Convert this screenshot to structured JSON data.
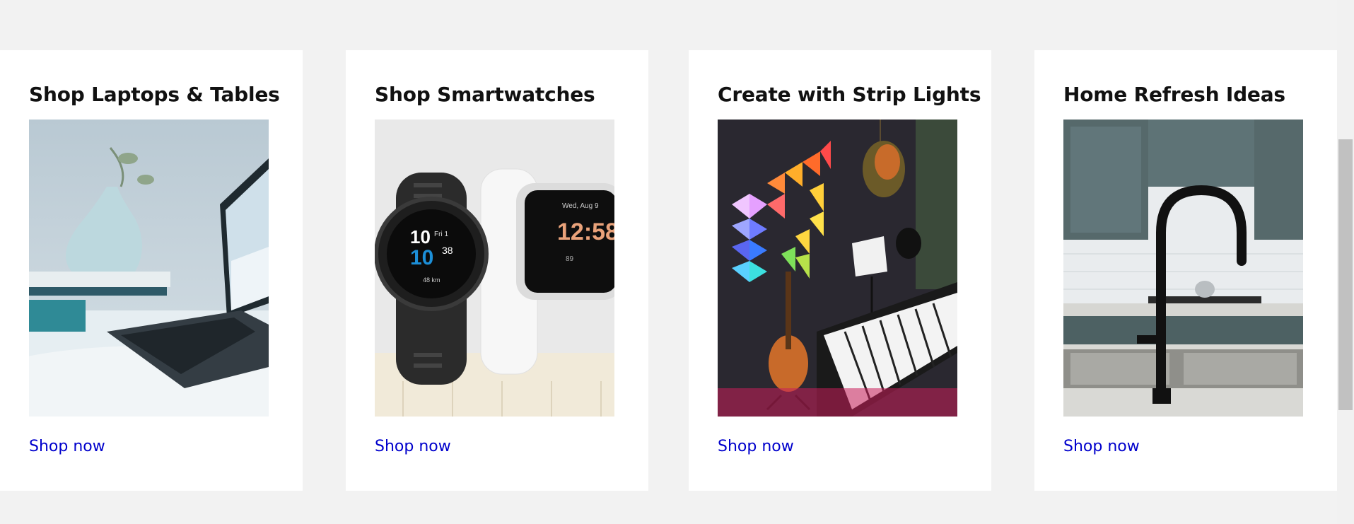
{
  "cards": [
    {
      "title": "Shop Laptops & Tables",
      "link": "Shop now",
      "image_icon": "laptop-vase-photo"
    },
    {
      "title": "Shop Smartwatches",
      "link": "Shop now",
      "image_icon": "smartwatches-photo",
      "watch_dark": {
        "hour": "10",
        "min": "10",
        "sec": "38",
        "day": "Fri 1",
        "dist": "48 km"
      },
      "watch_light": {
        "date": "Wed, Aug 9",
        "time": "12:58",
        "stat": "89"
      }
    },
    {
      "title": "Create with Strip Lights",
      "link": "Shop now",
      "image_icon": "strip-lights-photo"
    },
    {
      "title": "Home Refresh Ideas",
      "link": "Shop now",
      "image_icon": "kitchen-faucet-photo"
    }
  ],
  "colors": {
    "background": "#f2f2f2",
    "card": "#ffffff",
    "link": "#0000cc",
    "title": "#111111"
  }
}
